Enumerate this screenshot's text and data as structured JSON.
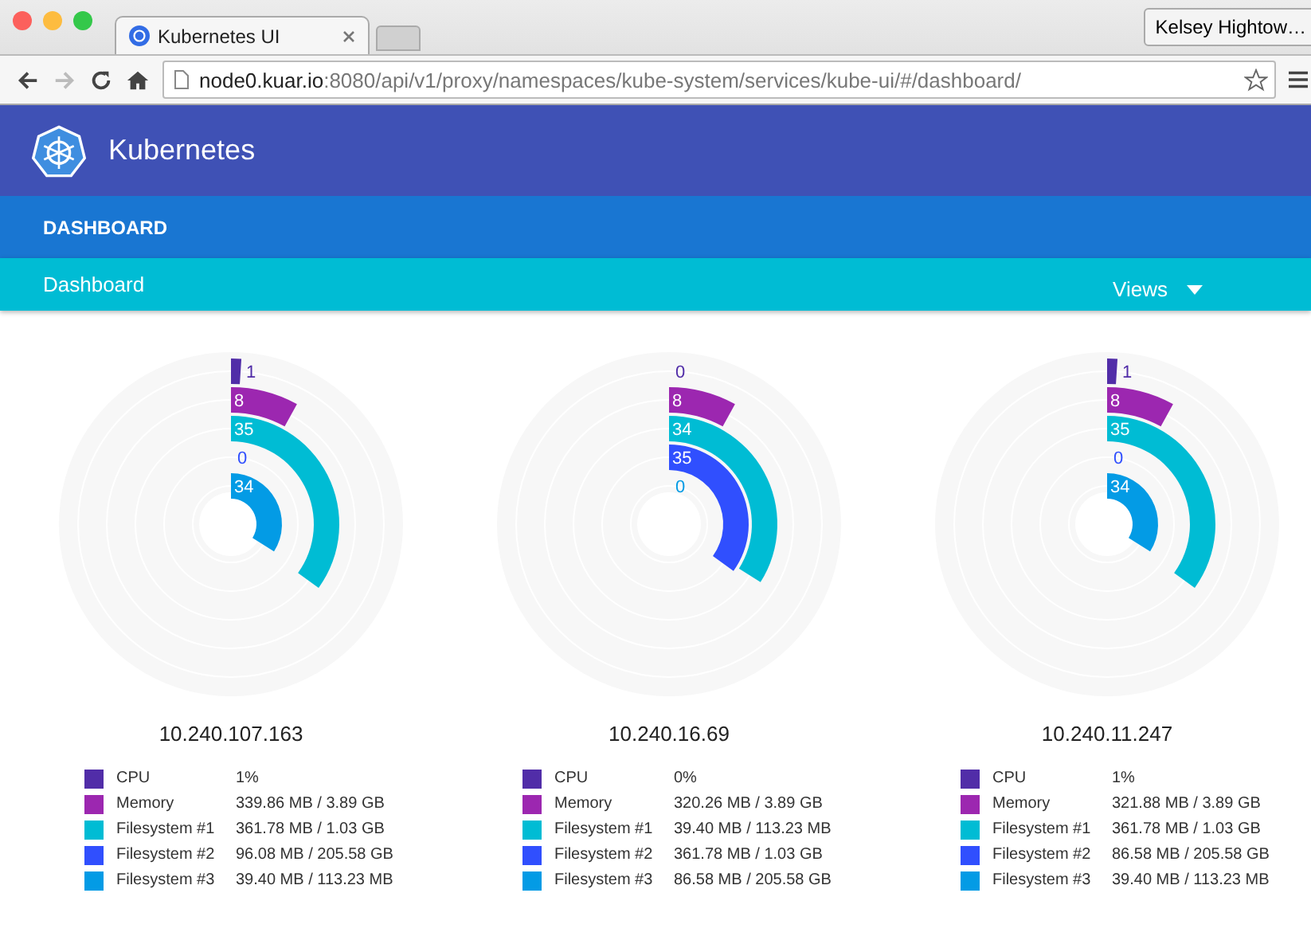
{
  "browser": {
    "tab_title": "Kubernetes UI",
    "profile": "Kelsey Hightow…",
    "url_host": "node0.kuar.io",
    "url_path": ":8080/api/v1/proxy/namespaces/kube-system/services/kube-ui/#/dashboard/"
  },
  "app": {
    "title": "Kubernetes",
    "section": "DASHBOARD",
    "breadcrumb": "Dashboard",
    "views": "Views"
  },
  "nodes": [
    {
      "ip": "10.240.107.163",
      "rings": [
        "1",
        "8",
        "35",
        "0",
        "34"
      ],
      "legend": [
        {
          "name": "CPU",
          "value": "1%",
          "color": "#512da8"
        },
        {
          "name": "Memory",
          "value": "339.86 MB / 3.89 GB",
          "color": "#9c27b0"
        },
        {
          "name": "Filesystem #1",
          "value": "361.78 MB / 1.03 GB",
          "color": "#00bcd4"
        },
        {
          "name": "Filesystem #2",
          "value": "96.08 MB / 205.58 GB",
          "color": "#304ffe"
        },
        {
          "name": "Filesystem #3",
          "value": "39.40 MB / 113.23 MB",
          "color": "#039be5"
        }
      ]
    },
    {
      "ip": "10.240.16.69",
      "rings": [
        "0",
        "8",
        "34",
        "35",
        "0"
      ],
      "legend": [
        {
          "name": "CPU",
          "value": "0%",
          "color": "#512da8"
        },
        {
          "name": "Memory",
          "value": "320.26 MB / 3.89 GB",
          "color": "#9c27b0"
        },
        {
          "name": "Filesystem #1",
          "value": "39.40 MB / 113.23 MB",
          "color": "#00bcd4"
        },
        {
          "name": "Filesystem #2",
          "value": "361.78 MB / 1.03 GB",
          "color": "#304ffe"
        },
        {
          "name": "Filesystem #3",
          "value": "86.58 MB / 205.58 GB",
          "color": "#039be5"
        }
      ]
    },
    {
      "ip": "10.240.11.247",
      "rings": [
        "1",
        "8",
        "35",
        "0",
        "34"
      ],
      "legend": [
        {
          "name": "CPU",
          "value": "1%",
          "color": "#512da8"
        },
        {
          "name": "Memory",
          "value": "321.88 MB / 3.89 GB",
          "color": "#9c27b0"
        },
        {
          "name": "Filesystem #1",
          "value": "361.78 MB / 1.03 GB",
          "color": "#00bcd4"
        },
        {
          "name": "Filesystem #2",
          "value": "86.58 MB / 205.58 GB",
          "color": "#304ffe"
        },
        {
          "name": "Filesystem #3",
          "value": "39.40 MB / 113.23 MB",
          "color": "#039be5"
        }
      ]
    }
  ]
}
